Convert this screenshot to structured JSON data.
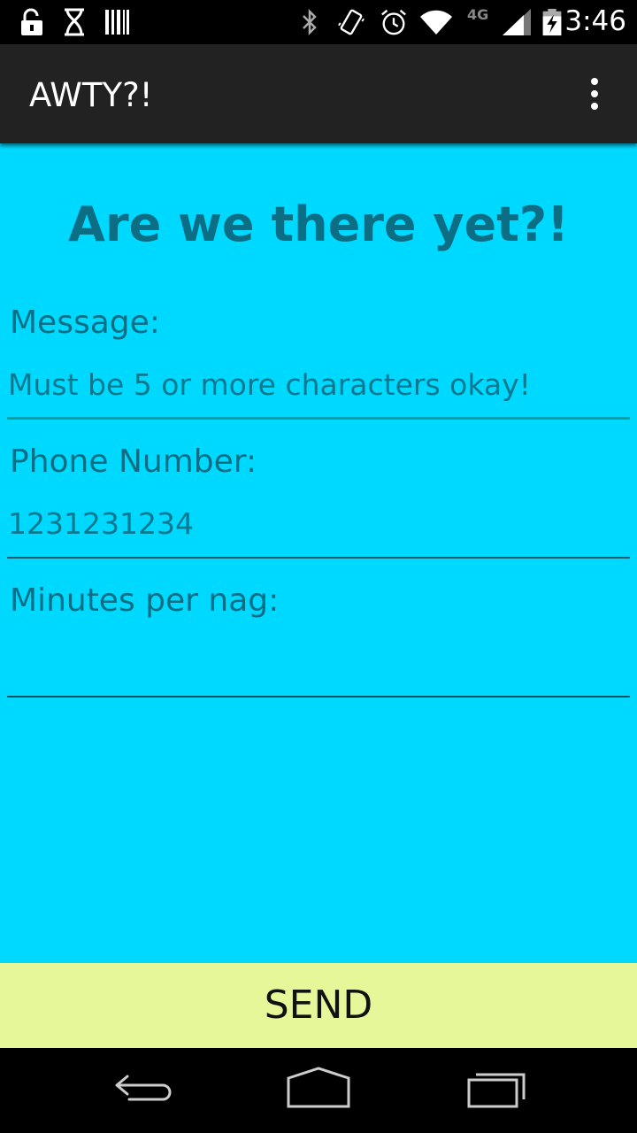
{
  "status_bar": {
    "time": "3:46",
    "network": "4G",
    "icons": [
      "unlock-icon",
      "hourglass-icon",
      "barcode-icon",
      "bluetooth-icon",
      "vibrate-icon",
      "alarm-icon",
      "wifi-icon",
      "signal-icon",
      "battery-charging-icon"
    ]
  },
  "action_bar": {
    "title": "AWTY?!",
    "overflow_icon": "overflow-menu-icon"
  },
  "main": {
    "headline": "Are we there yet?!",
    "fields": [
      {
        "label": "Message:",
        "value": "Must be 5 or more characters okay!"
      },
      {
        "label": "Phone Number:",
        "value": "1231231234"
      },
      {
        "label": "Minutes per nag:",
        "value": ""
      }
    ]
  },
  "send_button": {
    "label": "SEND"
  },
  "colors": {
    "background": "#00d9ff",
    "text": "#0b6e84",
    "send_bar": "#e6f79a",
    "action_bar": "#222222"
  },
  "nav_bar": {
    "icons": [
      "back-icon",
      "home-icon",
      "recent-apps-icon"
    ]
  }
}
